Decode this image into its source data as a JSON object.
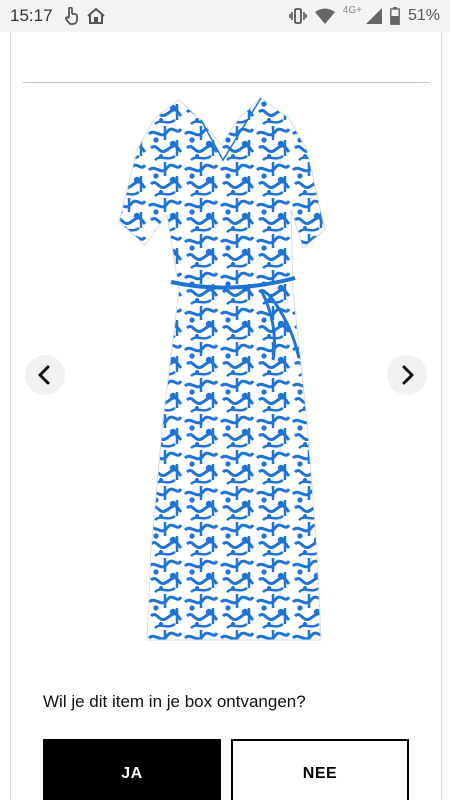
{
  "status_bar": {
    "time": "15:17",
    "network": "4G+",
    "battery": "51%",
    "icons_left": [
      "touch-icon",
      "home-icon"
    ],
    "icons_right": [
      "vibrate-icon",
      "wifi-icon",
      "signal-icon",
      "battery-icon"
    ]
  },
  "product": {
    "image_label": "wrap dress with blue abstract print",
    "colors": {
      "print": "#1e74d6",
      "base": "#ffffff"
    }
  },
  "carousel": {
    "prev_icon": "chevron-left-icon",
    "next_icon": "chevron-right-icon"
  },
  "prompt": {
    "question": "Wil je dit item in je box ontvangen?",
    "yes_label": "JA",
    "no_label": "NEE"
  }
}
